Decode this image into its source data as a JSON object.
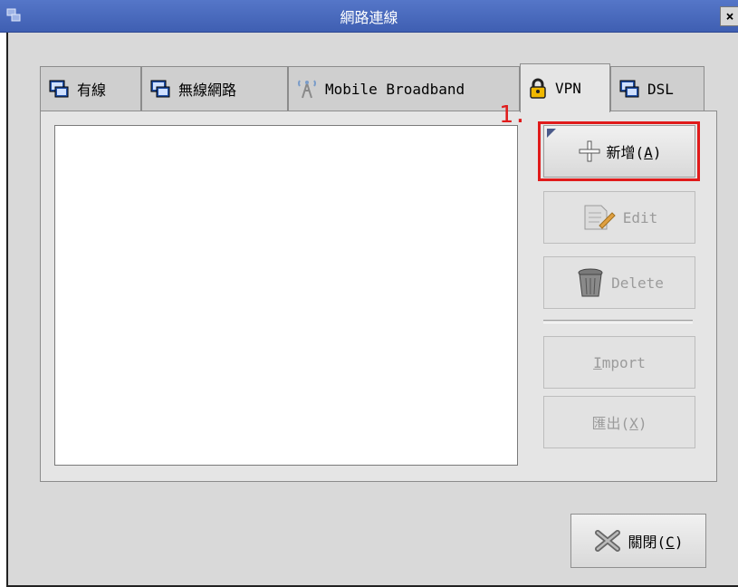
{
  "window": {
    "title": "網路連線",
    "close_glyph": "×"
  },
  "tabs": [
    {
      "label": "有線",
      "icon": "network-wired-icon"
    },
    {
      "label": "無線網路",
      "icon": "network-wireless-icon"
    },
    {
      "label": "Mobile Broadband",
      "icon": "mobile-broadband-antenna-icon"
    },
    {
      "label": "VPN",
      "icon": "padlock-icon",
      "active": true
    },
    {
      "label": "DSL",
      "icon": "network-dsl-icon"
    }
  ],
  "annotation": {
    "step": "1.",
    "highlight_color": "#e01b1b"
  },
  "buttons": {
    "add": {
      "label": "新增(",
      "mnemonic": "A",
      "suffix": ")",
      "icon": "plus-icon",
      "enabled": true
    },
    "edit": {
      "label": "Edit",
      "icon": "edit-document-icon",
      "enabled": false
    },
    "delete": {
      "label": "Delete",
      "icon": "trash-can-icon",
      "enabled": false
    },
    "import": {
      "mnemonic": "I",
      "rest": "mport",
      "enabled": false
    },
    "export": {
      "label": "匯出(",
      "mnemonic": "X",
      "suffix": ")",
      "enabled": false
    },
    "close": {
      "label": "關閉(",
      "mnemonic": "C",
      "suffix": ")",
      "icon": "close-x-icon"
    }
  },
  "colors": {
    "titlebar": "#4a6bbe",
    "dialog_bg": "#d9d9d9",
    "panel_bg": "#e5e5e5",
    "disabled_text": "#9b9b9b"
  }
}
